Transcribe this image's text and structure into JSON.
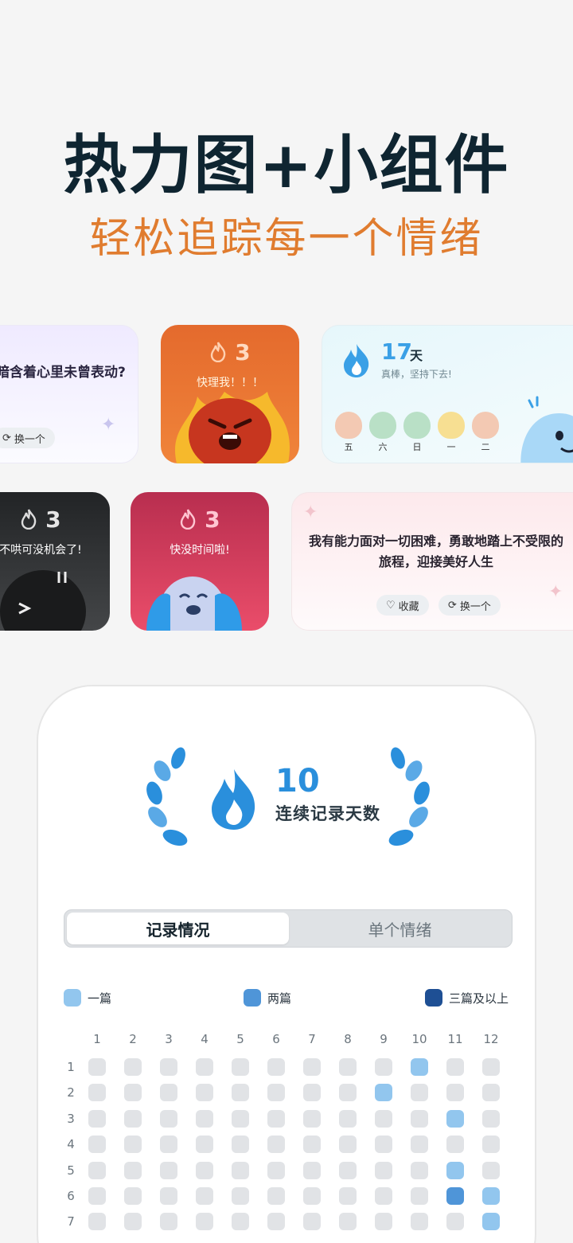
{
  "hero": {
    "title": "热力图+小组件",
    "subtitle": "轻松追踪每一个情绪"
  },
  "widgets": {
    "quote1": {
      "text": "暗含着心里未曾表动?",
      "refresh_label": "换一个"
    },
    "orange": {
      "streak": "3",
      "message": "快理我！！！"
    },
    "streak": {
      "days": "17",
      "unit": "天",
      "sub": "真棒，坚持下去!",
      "week": [
        {
          "day": "五",
          "color": "#f3c9b3"
        },
        {
          "day": "六",
          "color": "#b9e0c6"
        },
        {
          "day": "日",
          "color": "#b9e0c6"
        },
        {
          "day": "一",
          "color": "#f7df92"
        },
        {
          "day": "二",
          "color": "#f3c9b3"
        }
      ]
    },
    "dark": {
      "streak": "3",
      "message": "不哄可没机会了!"
    },
    "red": {
      "streak": "3",
      "message": "快没时间啦!"
    },
    "quote2": {
      "text": "我有能力面对一切困难，勇敢地踏上不受限的旅程，迎接美好人生",
      "collect_label": "收藏",
      "refresh_label": "换一个"
    }
  },
  "phone": {
    "streak_number": "10",
    "streak_label": "连续记录天数",
    "tabs": [
      "记录情况",
      "单个情绪"
    ],
    "legend": [
      {
        "label": "一篇",
        "color": "#92c6ee"
      },
      {
        "label": "两篇",
        "color": "#4f95d8"
      },
      {
        "label": "三篇及以上",
        "color": "#1e4f94"
      }
    ],
    "months": [
      "1",
      "2",
      "3",
      "4",
      "5",
      "6",
      "7",
      "8",
      "9",
      "10",
      "11",
      "12"
    ],
    "days": [
      "1",
      "2",
      "3",
      "4",
      "5",
      "6",
      "7"
    ],
    "heatmap": [
      [
        0,
        0,
        0,
        0,
        0,
        0,
        0,
        0,
        0,
        1,
        0,
        0
      ],
      [
        0,
        0,
        0,
        0,
        0,
        0,
        0,
        0,
        1,
        0,
        0,
        0
      ],
      [
        0,
        0,
        0,
        0,
        0,
        0,
        0,
        0,
        0,
        0,
        1,
        0
      ],
      [
        0,
        0,
        0,
        0,
        0,
        0,
        0,
        0,
        0,
        0,
        0,
        0
      ],
      [
        0,
        0,
        0,
        0,
        0,
        0,
        0,
        0,
        0,
        0,
        1,
        0
      ],
      [
        0,
        0,
        0,
        0,
        0,
        0,
        0,
        0,
        0,
        0,
        2,
        1
      ],
      [
        0,
        0,
        0,
        0,
        0,
        0,
        0,
        0,
        0,
        0,
        0,
        1
      ]
    ]
  }
}
